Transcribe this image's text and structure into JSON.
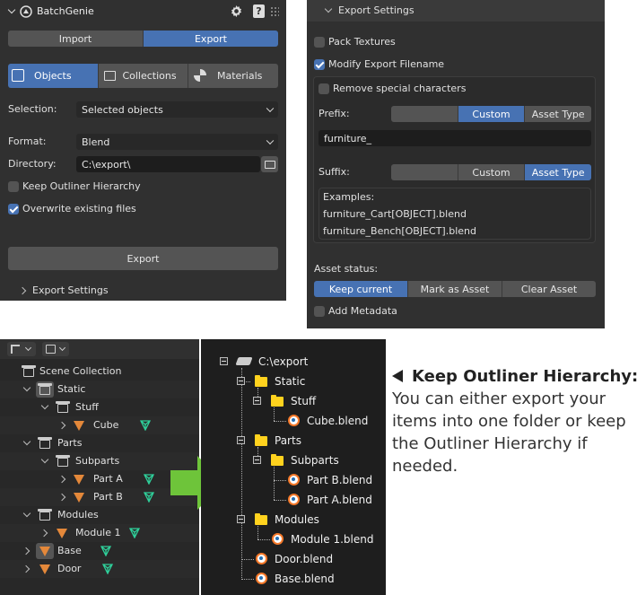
{
  "main_panel": {
    "title": "BatchGenie",
    "tabs": [
      "Import",
      "Export"
    ],
    "type_tabs": [
      "Objects",
      "Collections",
      "Materials"
    ],
    "selection_label": "Selection:",
    "selection_value": "Selected objects",
    "format_label": "Format:",
    "format_value": "Blend",
    "directory_label": "Directory:",
    "directory_value": "C:\\export\\",
    "keep_hierarchy_label": "Keep Outliner Hierarchy",
    "keep_hierarchy_checked": false,
    "overwrite_label": "Overwrite existing files",
    "overwrite_checked": true,
    "export_button": "Export",
    "export_settings_label": "Export Settings"
  },
  "settings_panel": {
    "header": "Export Settings",
    "pack_textures": "Pack Textures",
    "modify_filename": "Modify Export Filename",
    "remove_special": "Remove special characters",
    "prefix_label": "Prefix:",
    "prefix_options": [
      "",
      "Custom",
      "Asset Type"
    ],
    "prefix_value": "furniture_",
    "suffix_label": "Suffix:",
    "suffix_options": [
      "",
      "Custom",
      "Asset Type"
    ],
    "examples_label": "Examples:",
    "examples": [
      "furniture_Cart[OBJECT].blend",
      "furniture_Bench[OBJECT].blend"
    ],
    "asset_status_label": "Asset status:",
    "asset_status_options": [
      "Keep current",
      "Mark as Asset",
      "Clear Asset"
    ],
    "add_metadata": "Add Metadata"
  },
  "outliner": {
    "rows": [
      "Scene Collection",
      "Static",
      "Stuff",
      "Cube",
      "Parts",
      "Subparts",
      "Part A",
      "Part B",
      "Modules",
      "Module 1",
      "Base",
      "Door"
    ]
  },
  "file_tree": {
    "items": [
      "C:\\export",
      "Static",
      "Stuff",
      "Cube.blend",
      "Parts",
      "Subparts",
      "Part B.blend",
      "Part A.blend",
      "Modules",
      "Module 1.blend",
      "Door.blend",
      "Base.blend"
    ]
  },
  "caption": {
    "title": "Keep Outliner Hierarchy:",
    "body": "You can either export your items into one folder or keep the Outliner Hierarchy if needed."
  },
  "colors": {
    "accent": "#4772b3",
    "panel_bg": "#303030",
    "arrow_green": "#6ec43a",
    "mesh_green": "#2fcf9a",
    "object_orange": "#e4883a",
    "folder_yellow": "#ffd21e"
  }
}
